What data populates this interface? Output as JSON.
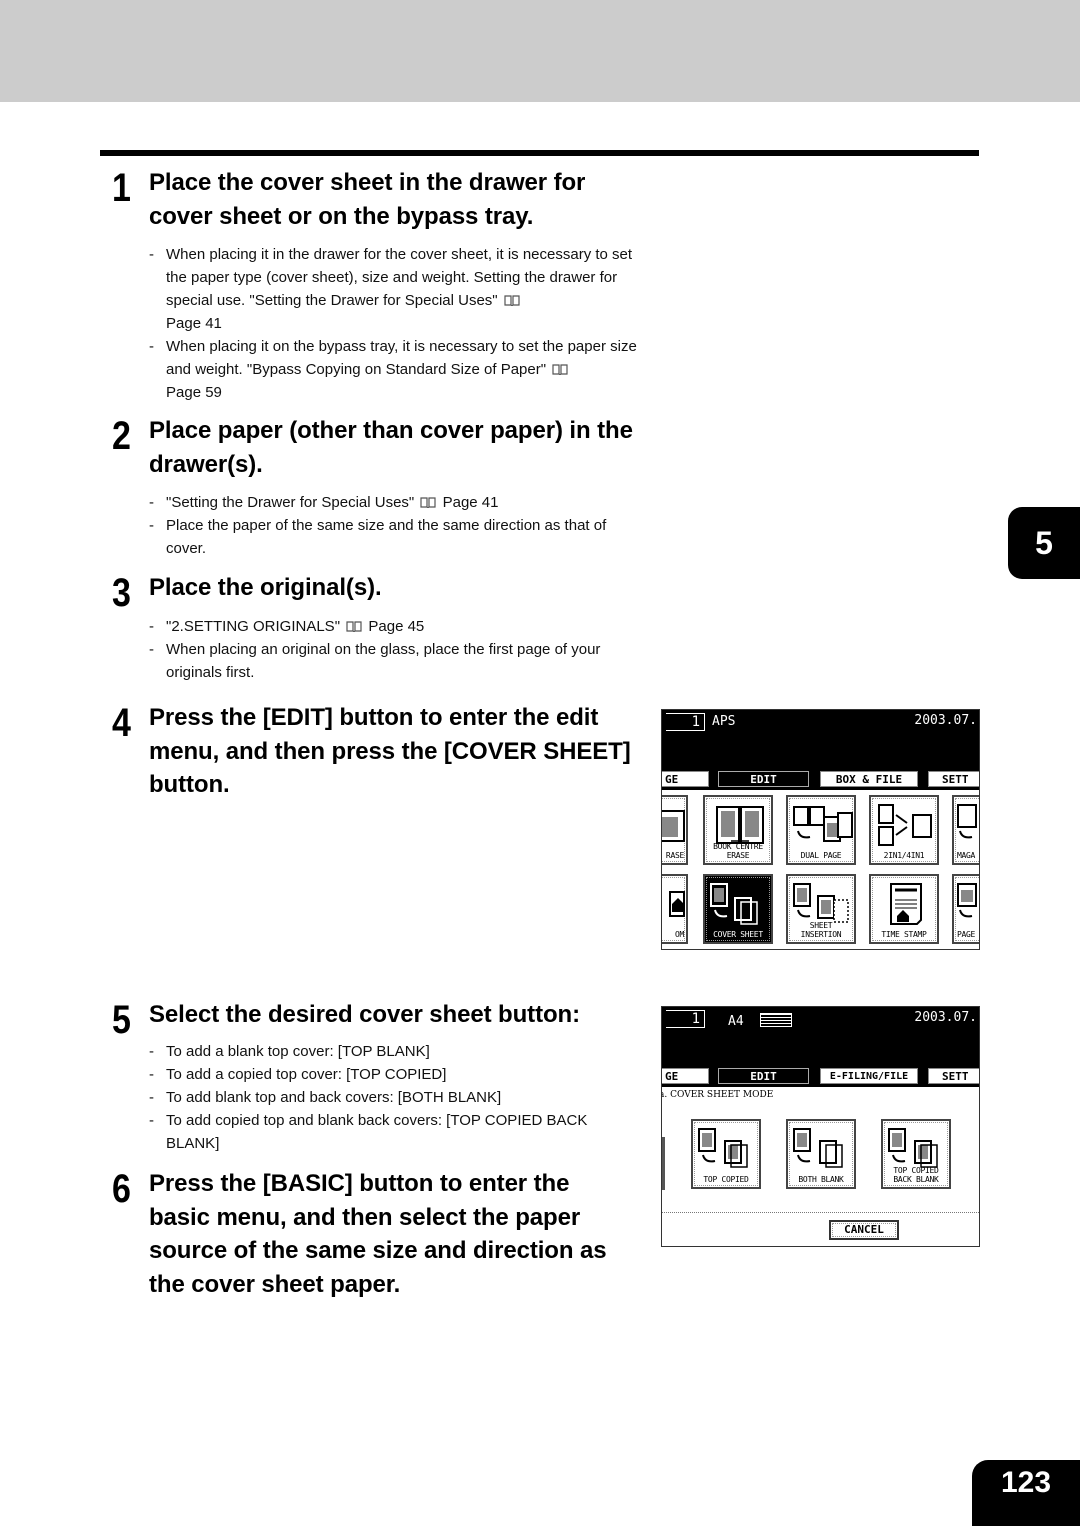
{
  "chapter_tab": "5",
  "page_number": "123",
  "steps": [
    {
      "number": "1",
      "title": "Place the cover sheet in the drawer for cover sheet or on the bypass tray.",
      "bullets": [
        {
          "text": "When placing it in the drawer for the cover sheet, it is necessary to set the paper type (cover sheet), size and weight. Setting the drawer for special use. \"Setting the Drawer for Special Uses\"",
          "ref": "Page 41"
        },
        {
          "text": "When placing it on the bypass tray, it is necessary to set the paper size and weight. \"Bypass Copying on Standard Size of Paper\"",
          "ref": "Page 59"
        }
      ]
    },
    {
      "number": "2",
      "title": "Place paper (other than cover paper) in the drawer(s).",
      "bullets": [
        {
          "text": "\"Setting the Drawer for Special Uses\"",
          "ref": "Page 41"
        },
        {
          "text": "Place the paper of the same size and the same direction as that of cover.",
          "ref": ""
        }
      ]
    },
    {
      "number": "3",
      "title": "Place the original(s).",
      "bullets": [
        {
          "text": "\"2.SETTING ORIGINALS\"",
          "ref": "Page 45"
        },
        {
          "text": "When placing an original on the glass, place the first page of your originals first.",
          "ref": ""
        }
      ]
    },
    {
      "number": "4",
      "title": "Press the [EDIT] button to enter the edit menu, and then press the [COVER SHEET] button."
    },
    {
      "number": "5",
      "title": "Select the desired cover sheet button:",
      "bullets": [
        {
          "text": "To add a blank top cover: [TOP BLANK]",
          "ref": ""
        },
        {
          "text": "To add a copied top cover: [TOP COPIED]",
          "ref": ""
        },
        {
          "text": "To add blank top and back covers: [BOTH BLANK]",
          "ref": ""
        },
        {
          "text": "To add copied top and blank back covers: [TOP COPIED BACK BLANK]",
          "ref": ""
        }
      ]
    },
    {
      "number": "6",
      "title": "Press the [BASIC] button to enter the basic menu, and then select the paper source of the same size and direction as the cover sheet paper."
    }
  ],
  "screen_edit": {
    "counter": "1",
    "mode": "APS",
    "date": "2003.07.",
    "tabs": [
      "GE",
      "EDIT",
      "BOX & FILE",
      "SETT"
    ],
    "active_tab": "EDIT",
    "row1": [
      "RASE",
      "BOOK CENTRE ERASE",
      "DUAL PAGE",
      "2IN1/4IN1",
      "MAGA"
    ],
    "row2": [
      "OM",
      "COVER SHEET",
      "SHEET INSERTION",
      "TIME STAMP",
      "PAGE"
    ],
    "selected": "COVER SHEET"
  },
  "screen_cover": {
    "counter": "1",
    "paper": "A4",
    "date": "2003.07.",
    "tabs": [
      "GE",
      "EDIT",
      "E-FILING/FILE",
      "SETT"
    ],
    "active_tab": "EDIT",
    "mode_label": "a. COVER SHEET MODE",
    "options": [
      "TOP COPIED",
      "BOTH BLANK",
      "TOP COPIED BACK BLANK"
    ],
    "cancel": "CANCEL"
  }
}
